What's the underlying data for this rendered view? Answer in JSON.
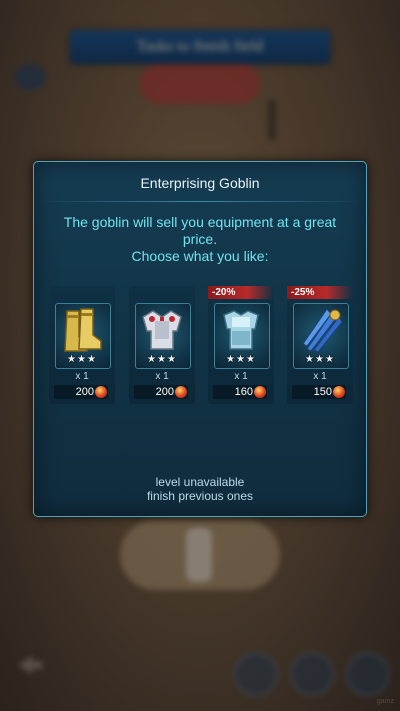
{
  "background": {
    "banner_text": "Tasks to finish field",
    "watermark": "gamz"
  },
  "popup": {
    "title": "Enterprising Goblin",
    "description_line1": "The goblin will sell you equipment at a great",
    "description_line2": "price.",
    "description_line3": "Choose what you like:",
    "status_line1": "level unavailable",
    "status_line2": "finish previous ones"
  },
  "items": [
    {
      "name": "golden-boots",
      "icon": "boots-icon",
      "stars": "★★★",
      "quantity": "x 1",
      "price": "200",
      "discount": ""
    },
    {
      "name": "silver-armor",
      "icon": "chest-armor-icon",
      "stars": "★★★",
      "quantity": "x 1",
      "price": "200",
      "discount": ""
    },
    {
      "name": "ice-armor",
      "icon": "plate-armor-icon",
      "stars": "★★★",
      "quantity": "x 1",
      "price": "160",
      "discount": "-20%"
    },
    {
      "name": "blue-claws",
      "icon": "claws-icon",
      "stars": "★★★",
      "quantity": "x 1",
      "price": "150",
      "discount": "-25%"
    }
  ],
  "colors": {
    "panel": "#123548",
    "border": "#4fa4bd",
    "description": "#6fe3ee",
    "discount": "#b62a2a"
  }
}
